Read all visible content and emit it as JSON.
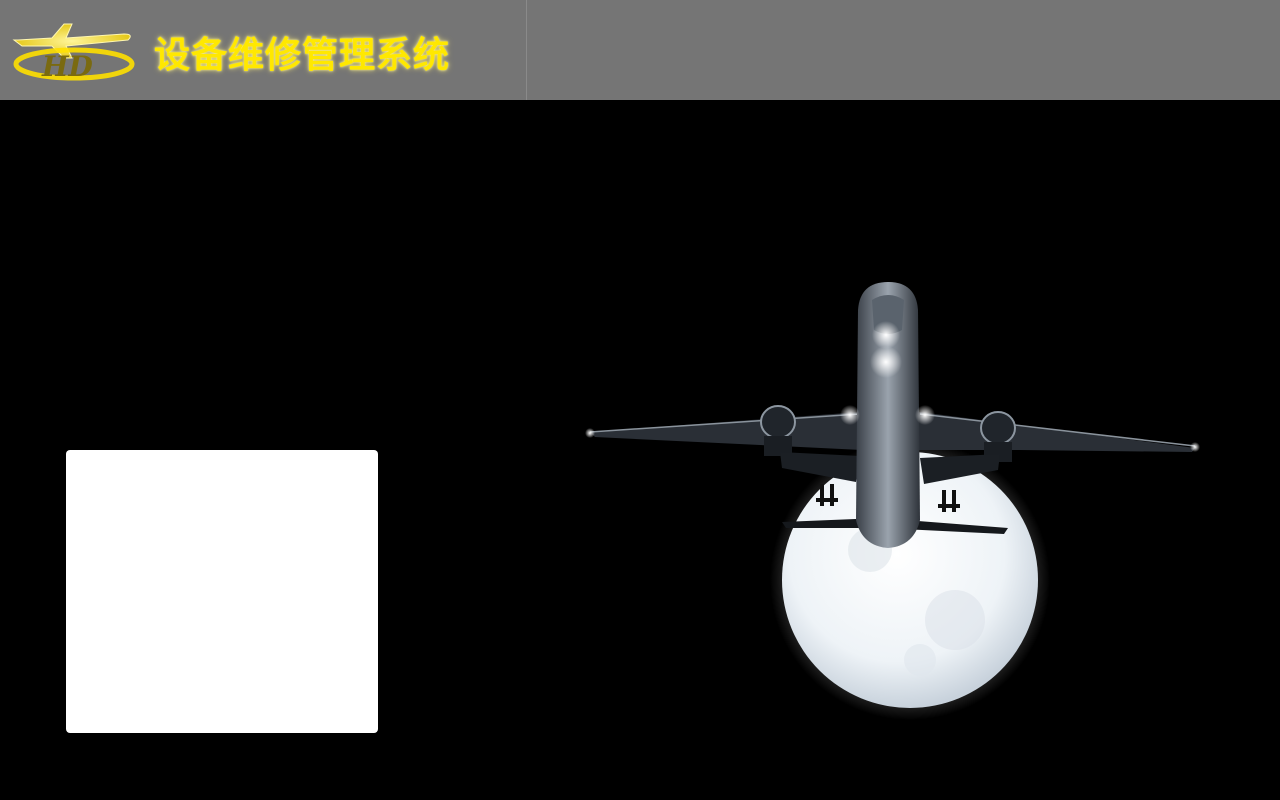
{
  "header": {
    "logo_icon": "hd-airplane-logo",
    "title": "设备维修管理系统",
    "title_color": "#ffe800",
    "background_color": "#757575"
  },
  "main": {
    "background_color": "#000000",
    "hero_image": "airplane-moon-image",
    "login_panel": {
      "background_color": "#ffffff"
    }
  }
}
